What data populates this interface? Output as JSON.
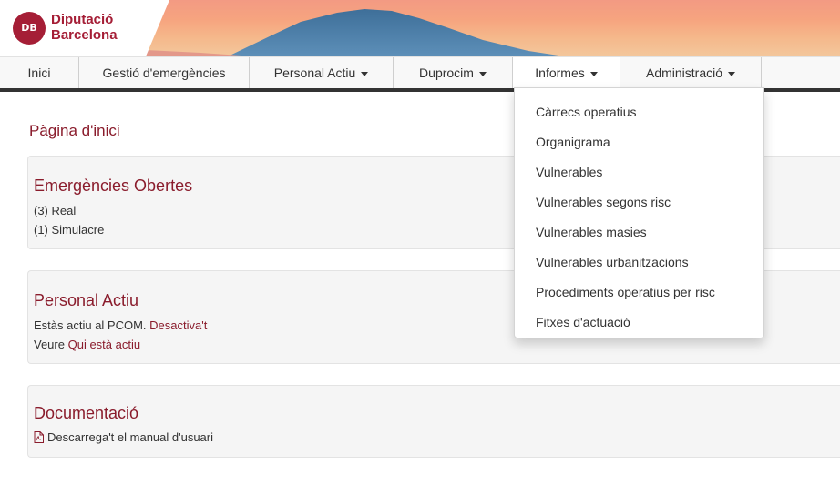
{
  "brand": {
    "line1": "Diputació",
    "line2": "Barcelona",
    "emblem": "DB"
  },
  "nav": [
    {
      "label": "Inici",
      "dropdown": false
    },
    {
      "label": "Gestió d'emergències",
      "dropdown": false
    },
    {
      "label": "Personal Actiu",
      "dropdown": true
    },
    {
      "label": "Duprocim",
      "dropdown": true
    },
    {
      "label": "Informes",
      "dropdown": true
    },
    {
      "label": "Administració",
      "dropdown": true
    }
  ],
  "page_title": "Pàgina d'inici",
  "emergencies": {
    "title": "Emergències Obertes",
    "real": "(3) Real",
    "simulacre": "(1) Simulacre"
  },
  "personal": {
    "title": "Personal Actiu",
    "status_text": "Estàs actiu al PCOM.",
    "deactivate_link": "Desactiva't",
    "see_prefix": "Veure",
    "who_link": "Qui està actiu"
  },
  "documentation": {
    "title": "Documentació",
    "manual_link": "Descarrega't el manual d'usuari"
  },
  "informes_menu": [
    "Càrrecs operatius",
    "Organigrama",
    "Vulnerables",
    "Vulnerables segons risc",
    "Vulnerables masies",
    "Vulnerables urbanitzacions",
    "Procediments operatius per risc",
    "Fitxes d'actuació"
  ],
  "colors": {
    "brand_red": "#a51e36",
    "link_red": "#8a1c2c"
  }
}
